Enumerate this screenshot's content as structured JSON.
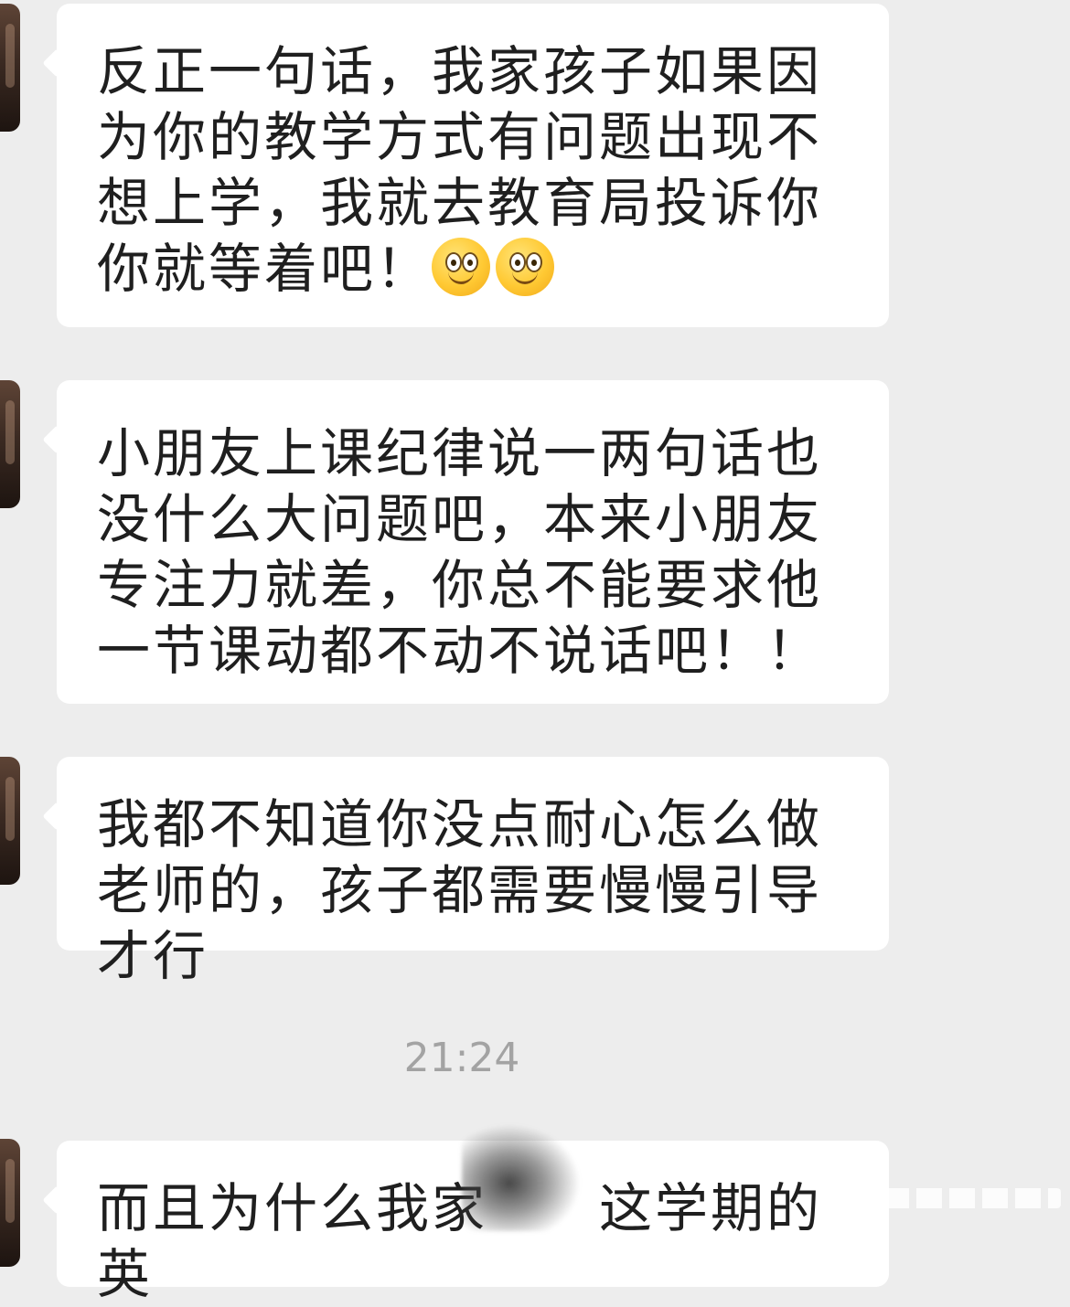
{
  "messages": [
    {
      "text": "反正一句话，我家孩子如果因为你的教学方式有问题出现不想上学，我就去教育局投诉你你就等着吧！",
      "emojis": [
        "smile-emoji",
        "smile-emoji"
      ]
    },
    {
      "text": "小朋友上课纪律说一两句话也没什么大问题吧，本来小朋友专注力就差，你总不能要求他一节课动都不动不说话吧！！"
    },
    {
      "text": "我都不知道你没点耐心怎么做老师的，孩子都需要慢慢引导才行"
    }
  ],
  "timestamp": "21:24",
  "last_message": {
    "text": "而且为什么我家",
    "text_after_redaction": "这学期的英"
  },
  "colors": {
    "chat_background": "#ededed",
    "bubble_background": "#ffffff",
    "text": "#1f1f1f",
    "timestamp": "#a3a3a3"
  }
}
